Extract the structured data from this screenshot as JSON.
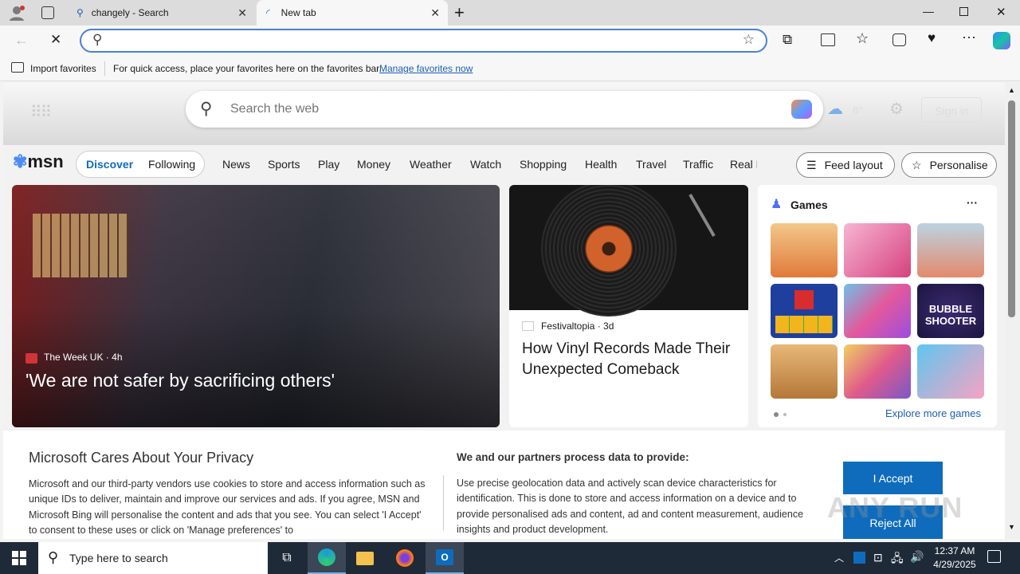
{
  "browser": {
    "tabs": [
      {
        "title": "changely - Search"
      },
      {
        "title": "New tab"
      }
    ],
    "address": {
      "value": "",
      "placeholder": ""
    },
    "favorites_bar": {
      "import_label": "Import favorites",
      "hint": "For quick access, place your favorites here on the favorites bar.",
      "manage_link": "Manage favorites now"
    }
  },
  "newtab": {
    "search_placeholder": "Search the web",
    "weather_temp": "8°",
    "sign_in": "Sign in"
  },
  "msn": {
    "logo": "msn",
    "tabs": [
      "Discover",
      "Following"
    ],
    "nav": [
      "News",
      "Sports",
      "Play",
      "Money",
      "Weather",
      "Watch",
      "Shopping",
      "Health",
      "Travel",
      "Traffic",
      "Real E"
    ],
    "feed_layout": "Feed layout",
    "personalise": "Personalise",
    "hero": {
      "source": "The Week UK",
      "age": "4h",
      "headline": "'We are not safer by sacrificing others'"
    },
    "card2": {
      "source": "Festivaltopia",
      "age": "3d",
      "headline": "How Vinyl Records Made Their Unexpected Comeback"
    },
    "games": {
      "title": "Games",
      "more": "···",
      "explore": "Explore more games",
      "tile_badge": "BUBBLE SHOOTER"
    }
  },
  "privacy": {
    "title": "Microsoft Cares About Your Privacy",
    "body": "Microsoft and our third-party vendors use cookies to store and access information such as unique IDs to deliver, maintain and improve our services and ads. If you agree, MSN and Microsoft Bing will personalise the content and ads that you see. You can select 'I Accept' to consent to these uses or click on 'Manage preferences' to",
    "partners_title": "We and our partners process data to provide:",
    "partners_body": "Use precise geolocation data and actively scan device characteristics for identification. This is done to store and access information on a device and to provide personalised ads and content, ad and content measurement, audience insights and product development.",
    "accept": "I Accept",
    "reject": "Reject All"
  },
  "taskbar": {
    "search_placeholder": "Type here to search",
    "time": "12:37 AM",
    "date": "4/29/2025"
  },
  "watermark": "ANY RUN",
  "colors": {
    "accent": "#0f6cbd",
    "taskbar": "#1f2a38",
    "link": "#1a5fb4"
  }
}
